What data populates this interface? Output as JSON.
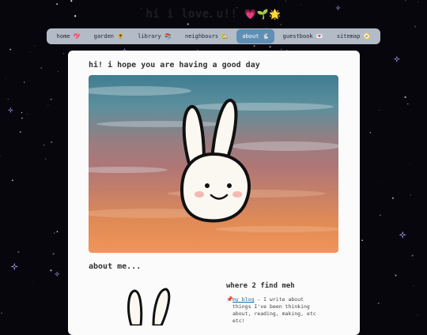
{
  "site": {
    "title": "hi i love u!!",
    "title_emoji": "💗🌱🌟"
  },
  "nav": [
    {
      "label": "home 💖"
    },
    {
      "label": "garden 🌻"
    },
    {
      "label": "library 📚"
    },
    {
      "label": "neighbours 🏡"
    },
    {
      "label": "about 🐇",
      "active": true
    },
    {
      "label": "guestbook 💌"
    },
    {
      "label": "sitemap 🧭"
    }
  ],
  "main": {
    "greeting": "hi! i hope you are having a good day",
    "about_heading": "about me...",
    "find_heading": "where 2 find meh",
    "links": [
      {
        "icon": "pushpin-icon",
        "pin": "📌",
        "link": "my blog",
        "text": " - I write about things I've been thinking about, reading, making, etc etc!"
      }
    ]
  },
  "colors": {
    "nav_active": "#5f8fb5",
    "nav_bg": "#b3bcc6",
    "star": "#b9a9ff",
    "link": "#1a6fb0"
  }
}
